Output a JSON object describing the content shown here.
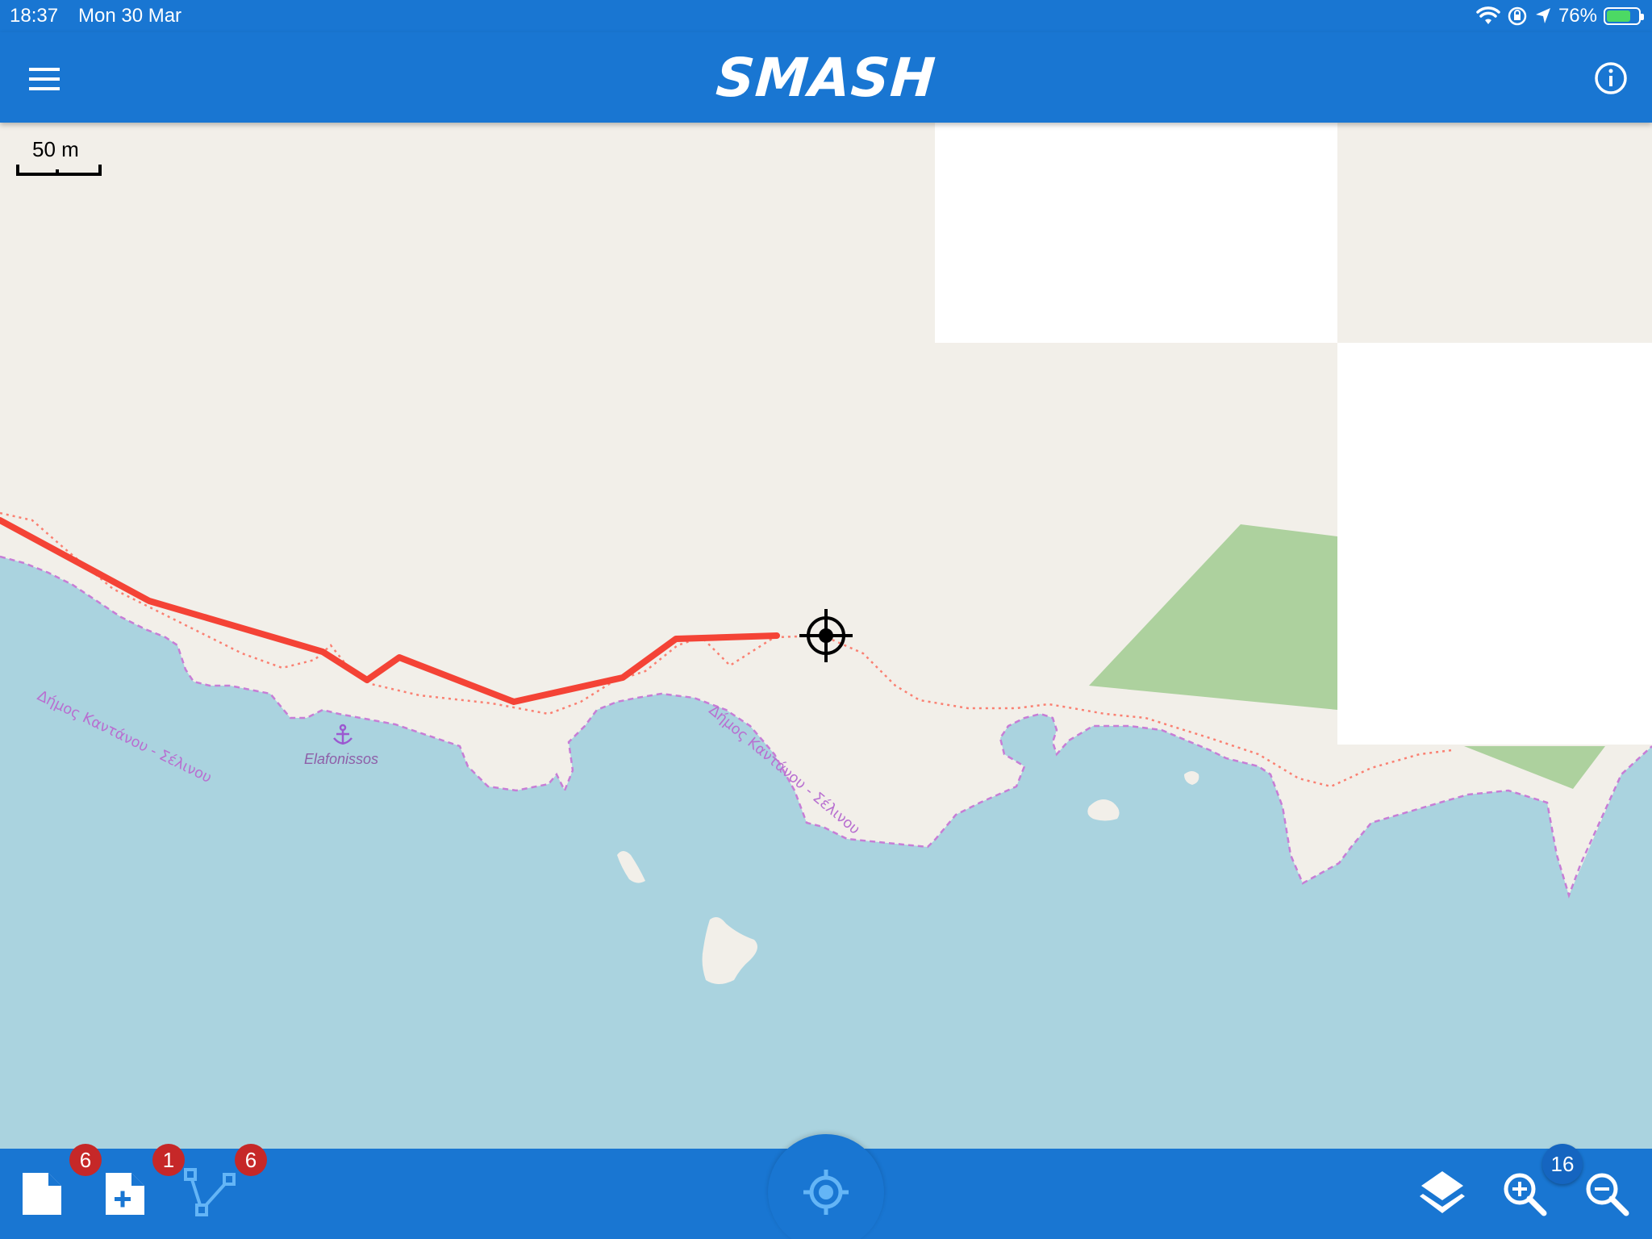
{
  "status_bar": {
    "time": "18:37",
    "date": "Mon 30 Mar",
    "battery_percent": "76%",
    "battery_level": 0.76,
    "icons": [
      "wifi-icon",
      "orientation-lock-icon",
      "location-arrow-icon",
      "battery-charging-icon"
    ]
  },
  "app_bar": {
    "title": "SMASH",
    "left_icon": "menu-icon",
    "right_icon": "info-icon"
  },
  "map": {
    "scale_label": "50 m",
    "labels": {
      "place": "Elafonissos",
      "municipality_1": "Δήμος Καντάνου - Σέλινου",
      "municipality_2": "Δήμος Καντάνου - Σέλινου"
    },
    "colors": {
      "land": "#f2efe9",
      "water": "#aad3df",
      "forest": "#add19e",
      "track": "#f44336",
      "boundary": "#c77dd6"
    }
  },
  "bottom_bar": {
    "notes_badge": "6",
    "add_note_badge": "1",
    "logs_badge": "6",
    "zoom_level": "16",
    "icons": [
      "notes-icon",
      "add-note-icon",
      "gps-log-icon",
      "center-on-gps-icon",
      "layers-icon",
      "zoom-in-icon",
      "zoom-out-icon"
    ],
    "accent_color": "#1976d2",
    "badge_color": "#c62828"
  }
}
